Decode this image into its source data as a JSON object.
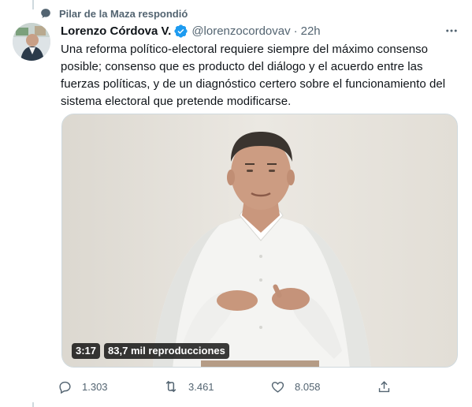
{
  "social_context": {
    "text": "Pilar de la Maza respondió",
    "icon": "reply-context-icon"
  },
  "tweet": {
    "display_name": "Lorenzo Córdova V.",
    "verified_icon": "verified-badge-icon",
    "handle": "@lorenzocordovav",
    "separator": "·",
    "time": "22h",
    "more_icon": "more-options-icon",
    "text": "Una reforma político-electoral requiere siempre del máximo consenso posible; consenso que es producto del diálogo y el acuerdo entre las fuerzas políticas, y de un diagnóstico certero sobre el funcionamiento del sistema electoral que pretende modificarse."
  },
  "media": {
    "duration": "3:17",
    "views": "83,7 mil reproducciones"
  },
  "actions": {
    "replies": "1.303",
    "retweets": "3.461",
    "likes": "8.058"
  },
  "colors": {
    "accent": "#1d9bf0",
    "secondary_text": "#536471",
    "primary_text": "#0f1419"
  }
}
